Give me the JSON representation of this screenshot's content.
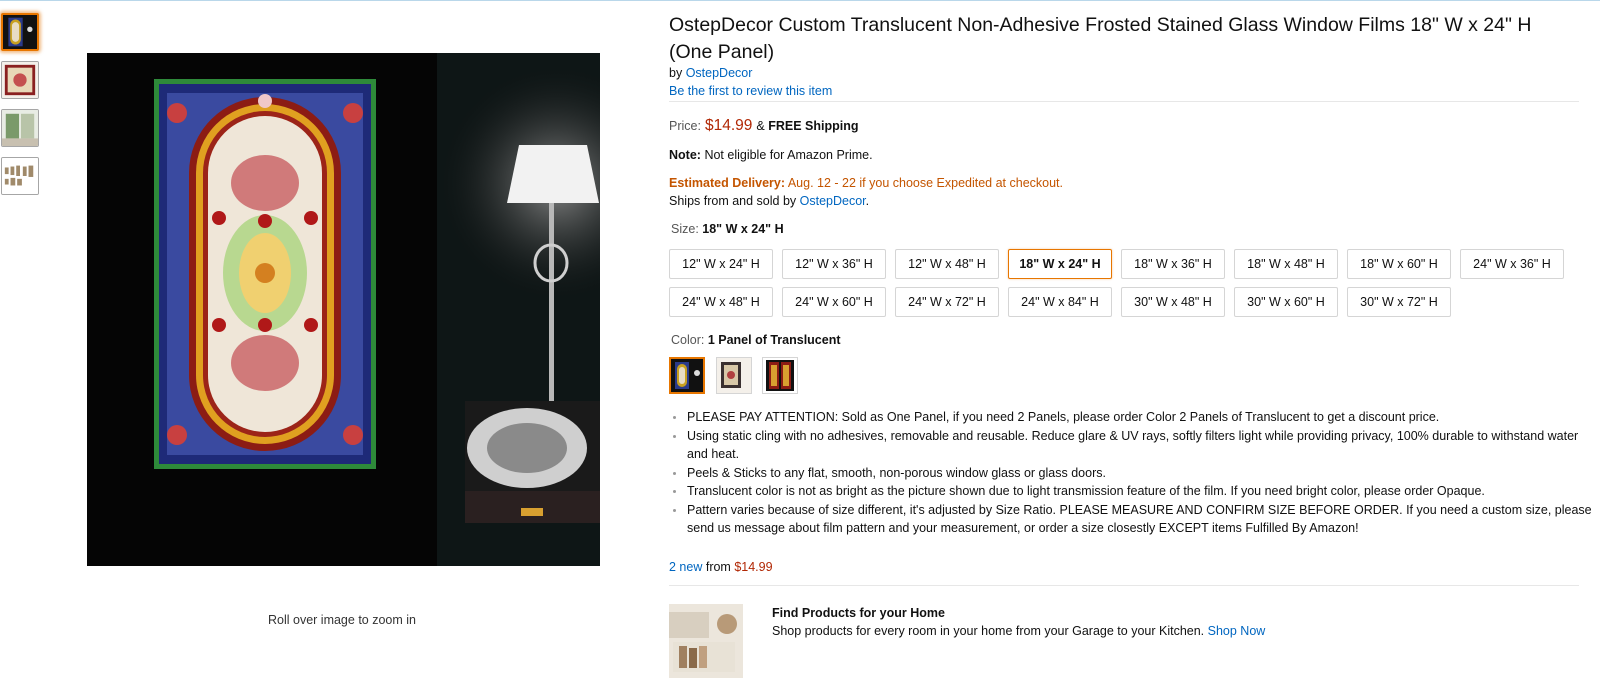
{
  "gallery": {
    "thumbnails": [
      "thumbnail-stained-glass-panel",
      "thumbnail-stained-glass-square",
      "thumbnail-room-window",
      "thumbnail-size-chart"
    ],
    "zoom_hint": "Roll over image to zoom in"
  },
  "product": {
    "title": "OstepDecor Custom Translucent Non-Adhesive Frosted Stained Glass Window Films 18\" W x 24\" H (One Panel)",
    "by_prefix": "by",
    "brand": "OstepDecor",
    "review_link": "Be the first to review this item"
  },
  "price": {
    "label": "Price:",
    "value": "$14.99",
    "amp": "&",
    "shipping": "FREE Shipping"
  },
  "note": {
    "label": "Note:",
    "text": "Not eligible for Amazon Prime."
  },
  "delivery": {
    "label": "Estimated Delivery:",
    "text": "Aug. 12 - 22 if you choose Expedited at checkout."
  },
  "ships": {
    "prefix": "Ships from and sold by",
    "seller": "OstepDecor",
    "suffix": "."
  },
  "size": {
    "label": "Size:",
    "selected": "18\" W x 24\" H",
    "options": [
      "12\" W x 24\" H",
      "12\" W x 36\" H",
      "12\" W x 48\" H",
      "18\" W x 24\" H",
      "18\" W x 36\" H",
      "18\" W x 48\" H",
      "18\" W x 60\" H",
      "24\" W x 36\" H",
      "24\" W x 48\" H",
      "24\" W x 60\" H",
      "24\" W x 72\" H",
      "24\" W x 84\" H",
      "30\" W x 48\" H",
      "30\" W x 60\" H",
      "30\" W x 72\" H"
    ]
  },
  "color": {
    "label": "Color:",
    "selected": "1 Panel of Translucent",
    "swatches": [
      "swatch-1-panel-translucent",
      "swatch-opaque",
      "swatch-2-panels-translucent"
    ]
  },
  "bullets": [
    "PLEASE PAY ATTENTION: Sold as One Panel, if you need 2 Panels, please order Color 2 Panels of Translucent to get a discount price.",
    "Using static cling with no adhesives, removable and reusable. Reduce glare & UV rays, softly filters light while providing privacy, 100% durable to withstand water and heat.",
    "Peels & Sticks to any flat, smooth, non-porous window glass or glass doors.",
    "Translucent color is not as bright as the picture shown due to light transmission feature of the film. If you need bright color, please order Opaque.",
    "Pattern varies because of size different, it's adjusted by Size Ratio. PLEASE MEASURE AND CONFIRM SIZE BEFORE ORDER. If you need a custom size, please send us message about film pattern and your measurement, or order a size closestly EXCEPT items Fulfilled By Amazon!"
  ],
  "offers": {
    "link": "2 new",
    "from": "from",
    "price": "$14.99"
  },
  "promo": {
    "title": "Find Products for your Home",
    "text": "Shop products for every room in your home from your Garage to your Kitchen.",
    "link": "Shop Now"
  },
  "colors": {
    "link": "#0066c0",
    "price": "#b12704",
    "delivery": "#c45500",
    "selected_border": "#e77600"
  }
}
